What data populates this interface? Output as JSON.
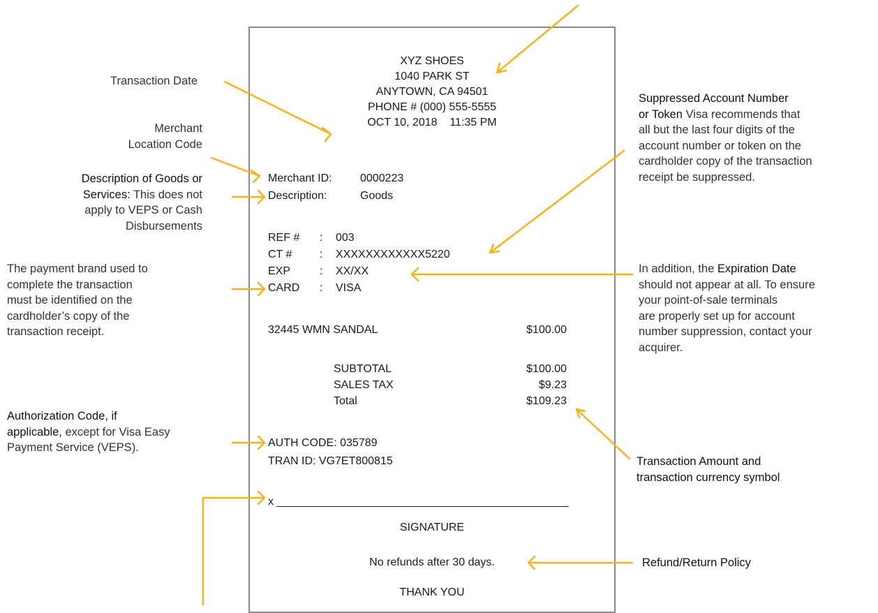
{
  "receipt": {
    "header": [
      "XYZ SHOES",
      "1040 PARK ST",
      "ANYTOWN, CA 94501",
      "PHONE # (000) 555-5555",
      "OCT 10, 2018    11:35 PM"
    ],
    "merchant_id_label": "Merchant ID:",
    "merchant_id_value": "0000223",
    "description_label": "Description:",
    "description_value": "Goods",
    "ref_label": "REF #",
    "ref_value": "003",
    "ct_label": "CT #",
    "ct_value": "XXXXXXXXXXXX5220",
    "exp_label": "EXP",
    "exp_value": "XX/XX",
    "card_label": "CARD",
    "card_value": "VISA",
    "colon": ":",
    "item_name": "32445 WMN SANDAL",
    "item_price": "$100.00",
    "subtotal_label": "SUBTOTAL",
    "subtotal_value": "$100.00",
    "tax_label": "SALES TAX",
    "tax_value": "$9.23",
    "total_label": "Total",
    "total_value": "$109.23",
    "auth_code": "AUTH CODE: 035789",
    "tran_id": "TRAN ID: VG7ET800815",
    "signature_line": "x _______________________________________________",
    "signature_label": "SIGNATURE",
    "refund_policy": "No refunds after 30 days.",
    "thank_you": "THANK YOU"
  },
  "annotations": {
    "transaction_date": "Transaction Date",
    "merchant_location_1": "Merchant",
    "merchant_location_2": "Location Code",
    "goods_1": "Description of Goods or",
    "goods_2a": "Services:",
    "goods_2b": " This does not",
    "goods_3": "apply to VEPS or Cash",
    "goods_4": "Disbursements",
    "brand_1": "The payment brand used to",
    "brand_2": "complete the transaction",
    "brand_3": "must be identified on the",
    "brand_4": "cardholder’s copy of the",
    "brand_5": "transaction receipt.",
    "auth_1": "Authorization Code, if",
    "auth_2a": "applicable,",
    "auth_2b": " except for Visa Easy",
    "auth_3": "Payment Service (VEPS).",
    "suppressed_1": "Suppressed Account Number",
    "suppressed_2a": "or Token",
    "suppressed_2b": " Visa recommends that",
    "suppressed_3": "all but the last four digits of the",
    "suppressed_4": "account number or token on the",
    "suppressed_5": "cardholder copy of the transaction",
    "suppressed_6": "receipt be suppressed.",
    "exp_1a": "In addition, the ",
    "exp_1b": "Expiration Date",
    "exp_2": "should not appear at all. To ensure",
    "exp_3": "your point-of-sale terminals",
    "exp_4": "are properly set up for account",
    "exp_5": "number suppression, contact your",
    "exp_6": "acquirer.",
    "amount_1": "Transaction Amount and",
    "amount_2": "transaction currency symbol",
    "refund": "Refund/Return Policy"
  },
  "colors": {
    "arrow": "#f7b21b",
    "border": "#8a8a8a"
  }
}
